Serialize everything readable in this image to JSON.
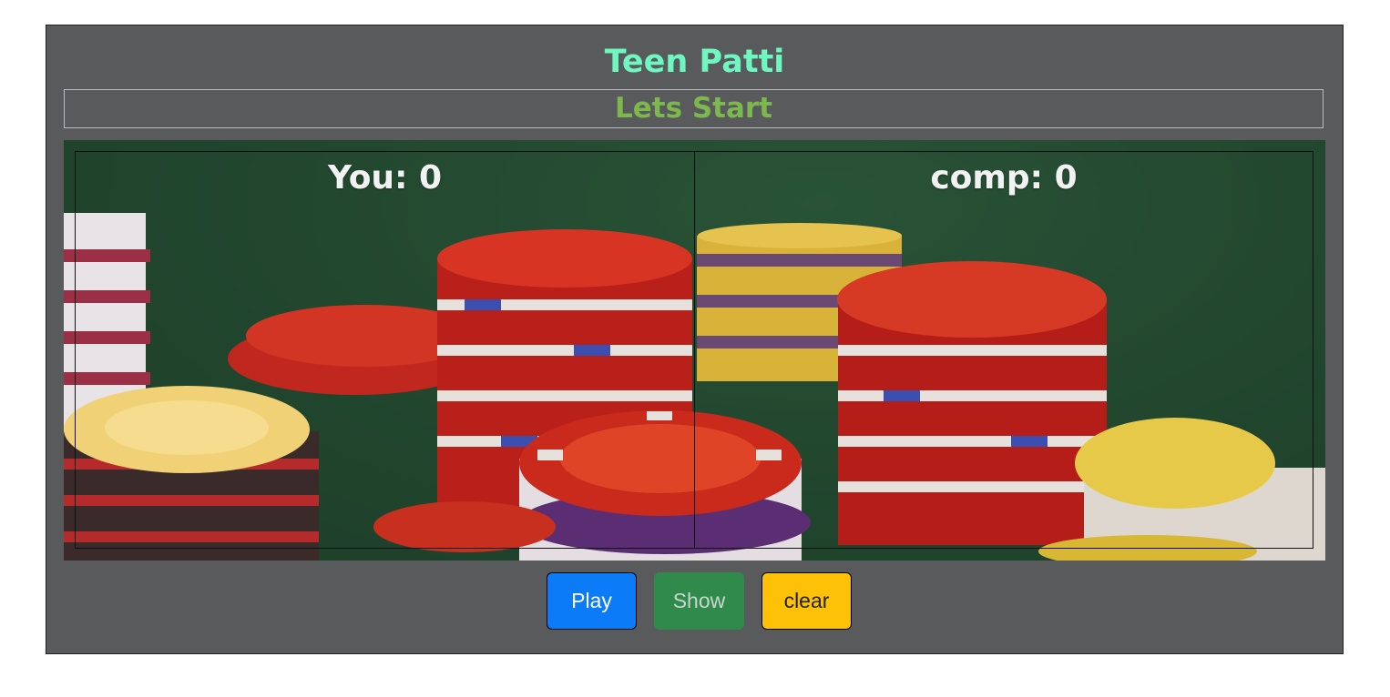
{
  "app": {
    "title": "Teen Patti",
    "status": "Lets Start"
  },
  "scores": {
    "you_label": "You: 0",
    "comp_label": "comp: 0"
  },
  "buttons": {
    "play": "Play",
    "show": "Show",
    "clear": "clear"
  },
  "colors": {
    "title": "#6ff7c2",
    "status": "#7db84e",
    "panel": "#595a5c",
    "play": "#0b7bf8",
    "show": "#2f8a4c",
    "clear": "#fdc107"
  },
  "background_image": "poker-chips-photo"
}
